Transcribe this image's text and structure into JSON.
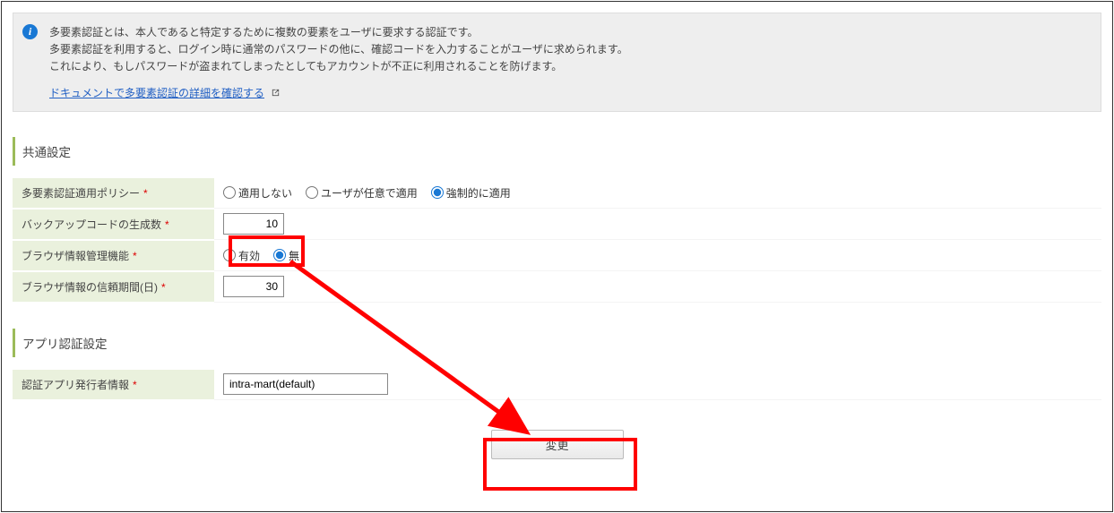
{
  "info": {
    "line1": "多要素認証とは、本人であると特定するために複数の要素をユーザに要求する認証です。",
    "line2": "多要素認証を利用すると、ログイン時に通常のパスワードの他に、確認コードを入力することがユーザに求められます。",
    "line3": "これにより、もしパスワードが盗まれてしまったとしてもアカウントが不正に利用されることを防げます。",
    "doc_link_label": "ドキュメントで多要素認証の詳細を確認する"
  },
  "section1_title": "共通設定",
  "section2_title": "アプリ認証設定",
  "labels": {
    "policy": "多要素認証適用ポリシー",
    "backup_count": "バックアップコードの生成数",
    "browser_mgmt": "ブラウザ情報管理機能",
    "browser_trust_days": "ブラウザ情報の信頼期間(日)",
    "issuer": "認証アプリ発行者情報"
  },
  "policy_options": {
    "none": "適用しない",
    "user": "ユーザが任意で適用",
    "force": "強制的に適用"
  },
  "browser_options": {
    "enable": "有効",
    "disable": "無"
  },
  "values": {
    "backup_count": "10",
    "trust_days": "30",
    "issuer": "intra-mart(default)"
  },
  "submit_label": "変更"
}
